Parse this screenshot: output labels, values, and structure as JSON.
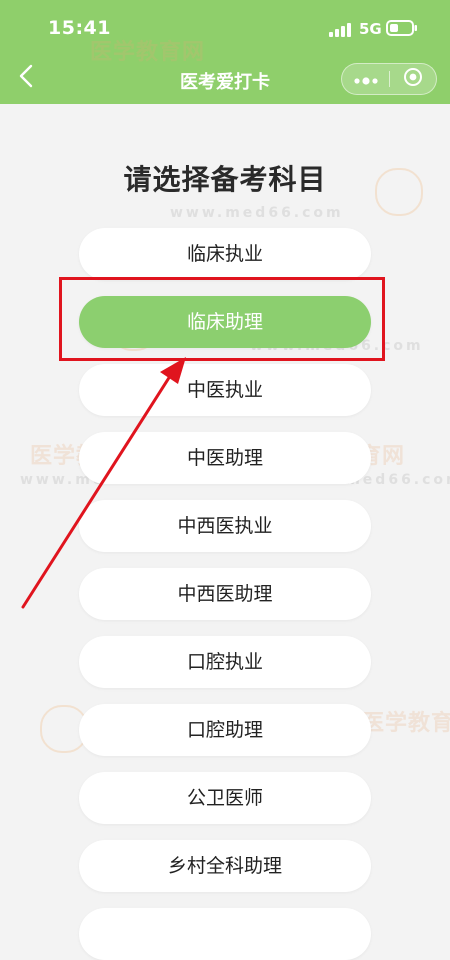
{
  "status_bar": {
    "time": "15:41",
    "network": "5G"
  },
  "nav": {
    "title": "医考爱打卡"
  },
  "watermark": {
    "brand": "医学教育网",
    "url": "www.med66.com",
    "seal": "正保"
  },
  "main": {
    "heading": "请选择备考科目",
    "selected_index": 1,
    "subjects": [
      {
        "label": "临床执业"
      },
      {
        "label": "临床助理"
      },
      {
        "label": "中医执业"
      },
      {
        "label": "中医助理"
      },
      {
        "label": "中西医执业"
      },
      {
        "label": "中西医助理"
      },
      {
        "label": "口腔执业"
      },
      {
        "label": "口腔助理"
      },
      {
        "label": "公卫医师"
      },
      {
        "label": "乡村全科助理"
      }
    ]
  },
  "colors": {
    "header_green": "#8fcf6b",
    "selected_green": "#8ccf6f",
    "annotation_red": "#e0141e",
    "background": "#f3f3f3"
  }
}
